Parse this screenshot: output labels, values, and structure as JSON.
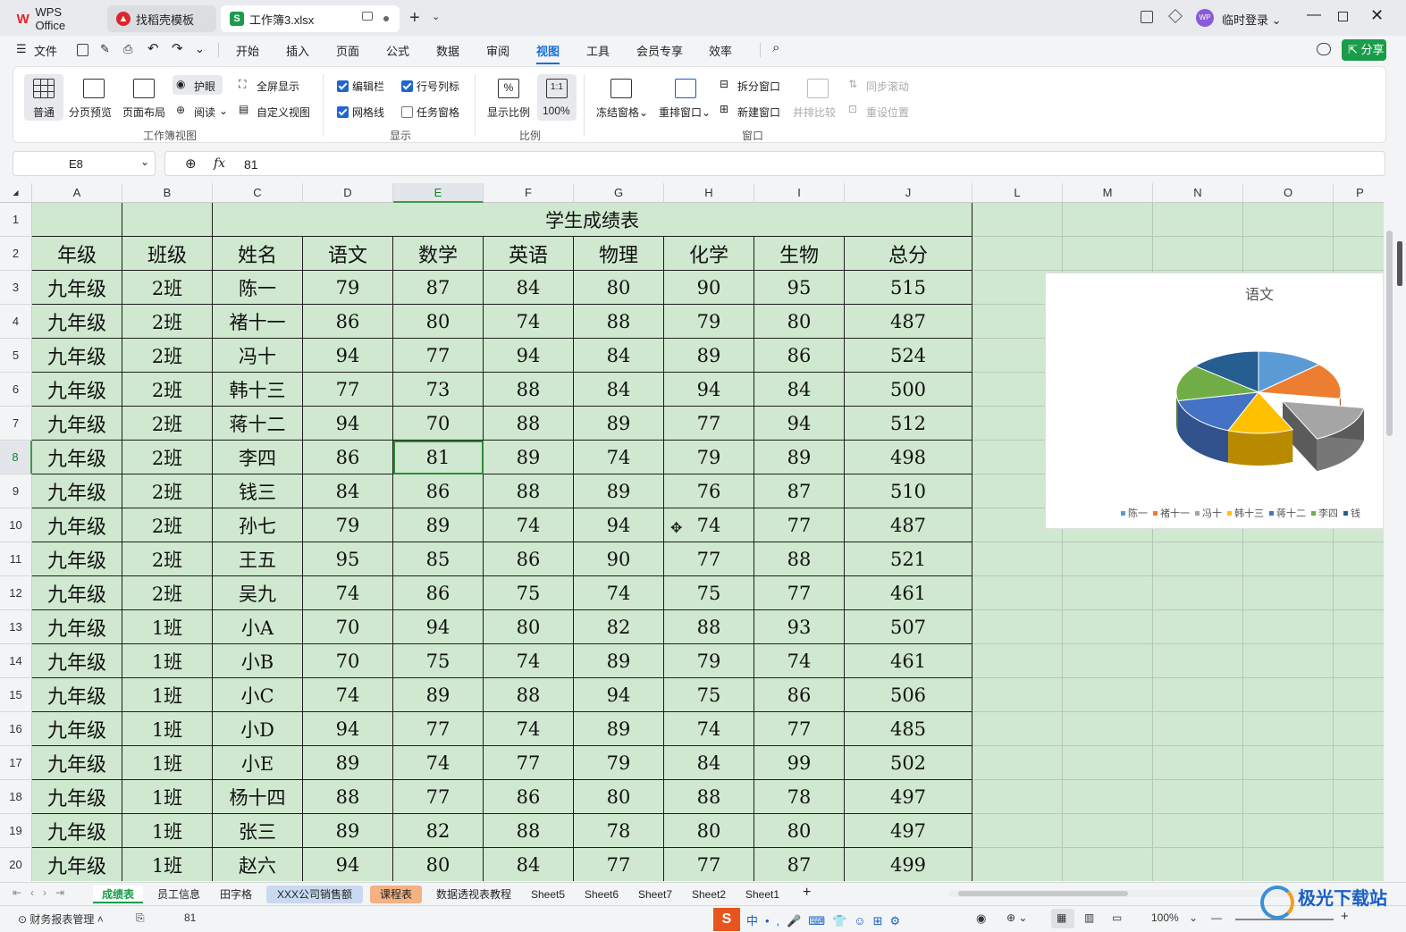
{
  "tabs": [
    {
      "label": "WPS Office",
      "icon": "wps-logo-icon"
    },
    {
      "label": "找稻壳模板",
      "icon": "docer-icon"
    },
    {
      "label": "工作簿3.xlsx",
      "icon": "spreadsheet-icon"
    }
  ],
  "window": {
    "login": "临时登录",
    "avatar": "WP"
  },
  "menu": {
    "file": "文件",
    "items": [
      "开始",
      "插入",
      "页面",
      "公式",
      "数据",
      "审阅",
      "视图",
      "工具",
      "会员专享",
      "效率"
    ],
    "active": "视图",
    "share": "分享"
  },
  "ribbon": {
    "normal": "普通",
    "page_break": "分页预览",
    "page_layout": "页面布局",
    "eye_care": "护眼",
    "read": "阅读",
    "fullscreen": "全屏显示",
    "custom_view": "自定义视图",
    "group_workbook_view": "工作簿视图",
    "formula_bar": "编辑栏",
    "row_col_headers": "行号列标",
    "gridlines": "网格线",
    "task_pane": "任务窗格",
    "group_show": "显示",
    "zoom": "显示比例",
    "zoom_100": "100%",
    "group_zoom": "比例",
    "freeze": "冻结窗格",
    "arrange": "重排窗口",
    "split": "拆分窗口",
    "new_window": "新建窗口",
    "side_by_side": "并排比较",
    "sync_scroll": "同步滚动",
    "reset_pos": "重设位置",
    "group_window": "窗口"
  },
  "formula_bar": {
    "cell_ref": "E8",
    "fx": "fx",
    "value": "81"
  },
  "columns": [
    "A",
    "B",
    "C",
    "D",
    "E",
    "F",
    "G",
    "H",
    "I",
    "J",
    "L",
    "M",
    "N",
    "O",
    "P"
  ],
  "rows": [
    "1",
    "2",
    "3",
    "4",
    "5",
    "6",
    "7",
    "8",
    "9",
    "10",
    "11",
    "12",
    "13",
    "14",
    "15",
    "16",
    "17",
    "18",
    "19",
    "20"
  ],
  "sheet": {
    "title": "学生成绩表",
    "headers": [
      "年级",
      "班级",
      "姓名",
      "语文",
      "数学",
      "英语",
      "物理",
      "化学",
      "生物",
      "总分"
    ],
    "data": [
      [
        "九年级",
        "2班",
        "陈一",
        "79",
        "87",
        "84",
        "80",
        "90",
        "95",
        "515"
      ],
      [
        "九年级",
        "2班",
        "褚十一",
        "86",
        "80",
        "74",
        "88",
        "79",
        "80",
        "487"
      ],
      [
        "九年级",
        "2班",
        "冯十",
        "94",
        "77",
        "94",
        "84",
        "89",
        "86",
        "524"
      ],
      [
        "九年级",
        "2班",
        "韩十三",
        "77",
        "73",
        "88",
        "84",
        "94",
        "84",
        "500"
      ],
      [
        "九年级",
        "2班",
        "蒋十二",
        "94",
        "70",
        "88",
        "89",
        "77",
        "94",
        "512"
      ],
      [
        "九年级",
        "2班",
        "李四",
        "86",
        "81",
        "89",
        "74",
        "79",
        "89",
        "498"
      ],
      [
        "九年级",
        "2班",
        "钱三",
        "84",
        "86",
        "88",
        "89",
        "76",
        "87",
        "510"
      ],
      [
        "九年级",
        "2班",
        "孙七",
        "79",
        "89",
        "74",
        "94",
        "74",
        "77",
        "487"
      ],
      [
        "九年级",
        "2班",
        "王五",
        "95",
        "85",
        "86",
        "90",
        "77",
        "88",
        "521"
      ],
      [
        "九年级",
        "2班",
        "吴九",
        "74",
        "86",
        "75",
        "74",
        "75",
        "77",
        "461"
      ],
      [
        "九年级",
        "1班",
        "小A",
        "70",
        "94",
        "80",
        "82",
        "88",
        "93",
        "507"
      ],
      [
        "九年级",
        "1班",
        "小B",
        "70",
        "75",
        "74",
        "89",
        "79",
        "74",
        "461"
      ],
      [
        "九年级",
        "1班",
        "小C",
        "74",
        "89",
        "88",
        "94",
        "75",
        "86",
        "506"
      ],
      [
        "九年级",
        "1班",
        "小D",
        "94",
        "77",
        "74",
        "89",
        "74",
        "77",
        "485"
      ],
      [
        "九年级",
        "1班",
        "小E",
        "89",
        "74",
        "77",
        "79",
        "84",
        "99",
        "502"
      ],
      [
        "九年级",
        "1班",
        "杨十四",
        "88",
        "77",
        "86",
        "80",
        "88",
        "78",
        "497"
      ],
      [
        "九年级",
        "1班",
        "张三",
        "89",
        "82",
        "88",
        "78",
        "80",
        "80",
        "497"
      ],
      [
        "九年级",
        "1班",
        "赵六",
        "94",
        "80",
        "84",
        "77",
        "77",
        "87",
        "499"
      ]
    ]
  },
  "chart_data": {
    "type": "pie",
    "title": "语文",
    "categories": [
      "陈一",
      "褚十一",
      "冯十",
      "韩十三",
      "蒋十二",
      "李四",
      "钱三"
    ],
    "legend_visible": [
      "陈一",
      "褚十一",
      "冯十",
      "韩十三",
      "蒋十二",
      "李四",
      "钱"
    ],
    "values": [
      79,
      86,
      94,
      77,
      94,
      86,
      84
    ],
    "colors": [
      "#5b9bd5",
      "#ed7d31",
      "#a5a5a5",
      "#ffc000",
      "#4472c4",
      "#70ad47",
      "#255e91"
    ],
    "legend": "bottom"
  },
  "sheet_tabs": [
    {
      "label": "成绩表",
      "active": true
    },
    {
      "label": "员工信息"
    },
    {
      "label": "田字格"
    },
    {
      "label": "XXX公司销售额",
      "color": "#c9daf0"
    },
    {
      "label": "课程表",
      "color": "#f4b183"
    },
    {
      "label": "数据透视表教程"
    },
    {
      "label": "Sheet5"
    },
    {
      "label": "Sheet6"
    },
    {
      "label": "Sheet7"
    },
    {
      "label": "Sheet2"
    },
    {
      "label": "Sheet1"
    }
  ],
  "status": {
    "macro": "财务报表管理",
    "value": "81",
    "zoom": "100%"
  },
  "watermark": "极光下载站"
}
